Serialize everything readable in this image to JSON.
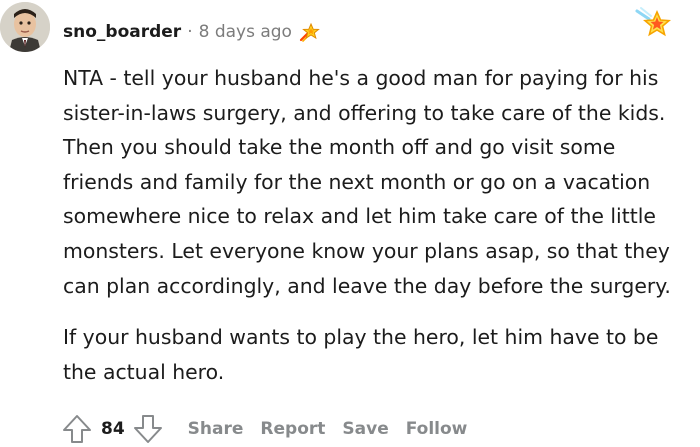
{
  "comment": {
    "author": "sno_boarder",
    "separator": "·",
    "timestamp": "8 days ago",
    "body_lines": [
      "NTA - tell your husband he's a good man for paying for his",
      "sister-in-laws surgery, and offering to take care of the kids.",
      "Then you should take the month off and go visit some",
      "friends and family for the next month or go on a vacation",
      "somewhere nice to relax and let him take care of the little",
      "monsters. Let everyone know your plans asap, so that they",
      "can plan accordingly, and leave the day before the surgery."
    ],
    "body_lines_2": [
      "If your husband wants to play the hero, let him have to be",
      "the actual hero."
    ]
  },
  "actions": {
    "score": "84",
    "share_label": "Share",
    "report_label": "Report",
    "save_label": "Save",
    "follow_label": "Follow"
  },
  "icons": {
    "upvote": "upvote-arrow-icon",
    "downvote": "downvote-arrow-icon",
    "award_small": "rocket-like-award-icon",
    "award_large": "star-award-icon"
  },
  "colors": {
    "text": "#1c1c1c",
    "meta": "#7c7c7c",
    "action": "#878a8c",
    "award_star": "#f5a623",
    "award_accent": "#ff4500"
  }
}
